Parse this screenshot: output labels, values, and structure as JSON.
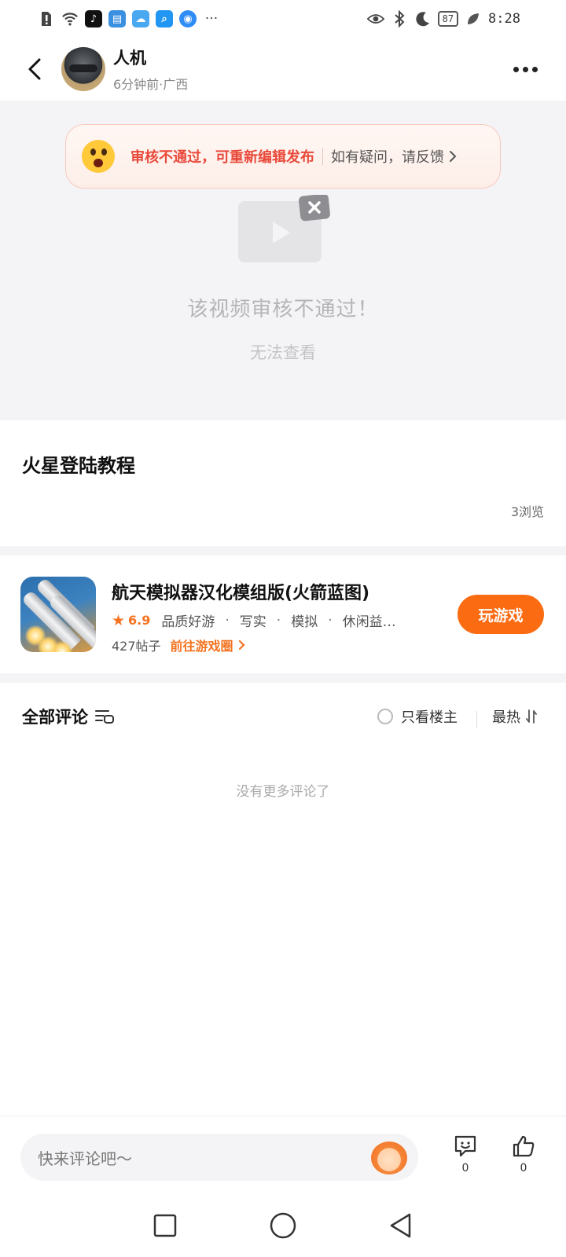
{
  "status_bar": {
    "battery": "87",
    "time": "8:28",
    "more": "···"
  },
  "header": {
    "user_name": "人机",
    "user_meta": "6分钟前·广西"
  },
  "video": {
    "banner_main": "审核不通过，可重新编辑发布",
    "banner_feedback": "如有疑问，请反馈",
    "blocked_title": "该视频审核不通过！",
    "blocked_sub": "无法查看"
  },
  "post": {
    "title": "火星登陆教程",
    "views": "3浏览"
  },
  "game": {
    "name": "航天模拟器汉化模组版(火箭蓝图)",
    "rating": "6.9",
    "tags": [
      "品质好游",
      "写实",
      "模拟",
      "休闲益…"
    ],
    "posts": "427帖子",
    "goto_label": "前往游戏圈",
    "play_label": "玩游戏"
  },
  "comments": {
    "title": "全部评论",
    "owner_only": "只看楼主",
    "sort": "最热",
    "empty": "没有更多评论了"
  },
  "input_bar": {
    "placeholder": "快来评论吧～",
    "comment_count": "0",
    "like_count": "0"
  },
  "colors": {
    "accent": "#fb6b12",
    "warning_text": "#e9493a",
    "muted_bg": "#f4f4f6"
  }
}
